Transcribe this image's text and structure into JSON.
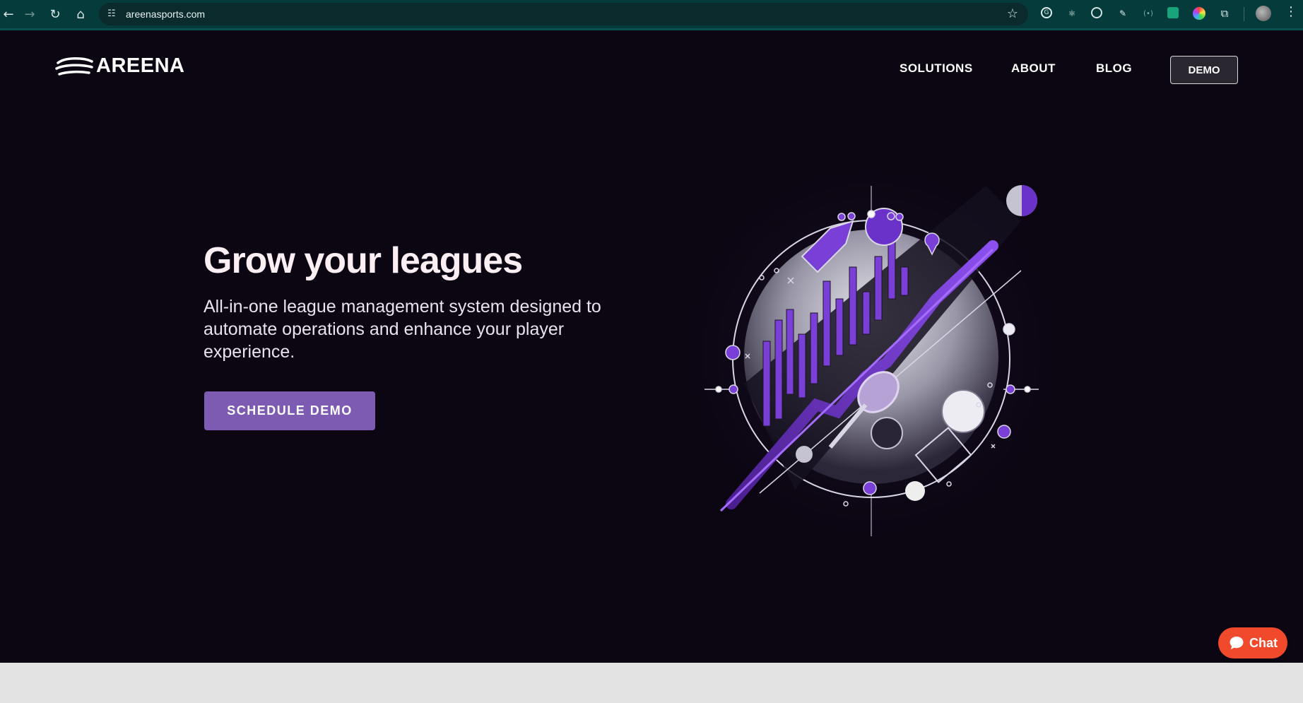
{
  "browser": {
    "url": "areenasports.com",
    "icons": {
      "back": "arrow-left-icon",
      "forward": "arrow-right-icon",
      "reload": "reload-icon",
      "home": "home-icon",
      "site_info": "tune-icon",
      "bookmark": "star-icon",
      "menu": "kebab-menu-icon"
    },
    "extensions": [
      "grammarly-icon",
      "react-devtools-icon",
      "target-icon",
      "eyedropper-icon",
      "broadcast-icon",
      "chatgpt-icon",
      "color-ring-icon",
      "puzzle-icon"
    ]
  },
  "header": {
    "logo_text": "AREENA",
    "nav": [
      "SOLUTIONS",
      "ABOUT",
      "BLOG"
    ],
    "demo_label": "DEMO"
  },
  "hero": {
    "title": "Grow your leagues",
    "subtitle": "All-in-one league management system designed to automate operations and enhance your player experience.",
    "cta_label": "SCHEDULE DEMO",
    "illustration": "sports-growth-illustration"
  },
  "chat": {
    "label": "Chat"
  },
  "colors": {
    "background": "#0c0613",
    "accent": "#7d5bb3",
    "chrome": "#063b3b",
    "chat": "#f0492c"
  }
}
